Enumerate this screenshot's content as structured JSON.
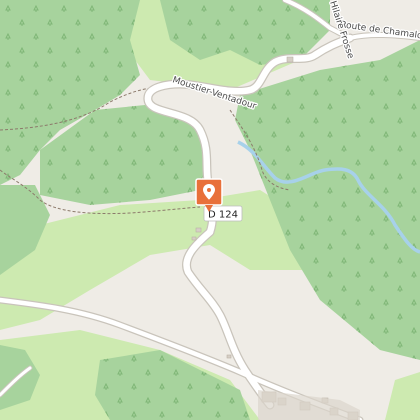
{
  "map": {
    "road_ref": "D 124",
    "road_names": [
      {
        "id": "moustier",
        "text": "Moustier-Ventadour"
      },
      {
        "id": "chamalot",
        "text": "Route de Chamalot"
      },
      {
        "id": "hilaire",
        "text": "Hilaire Frosse"
      }
    ],
    "marker": {
      "icon": "location-pin-icon",
      "color": "#e8703a"
    },
    "colors": {
      "forest": "#a7d39d",
      "forest_dark": "#9fce95",
      "meadow": "#cdeab0",
      "background": "#efece6",
      "road": "#ffffff",
      "road_casing": "#c9c4bb",
      "river": "#a7d1ea",
      "trail": "#8c7a6b"
    }
  }
}
